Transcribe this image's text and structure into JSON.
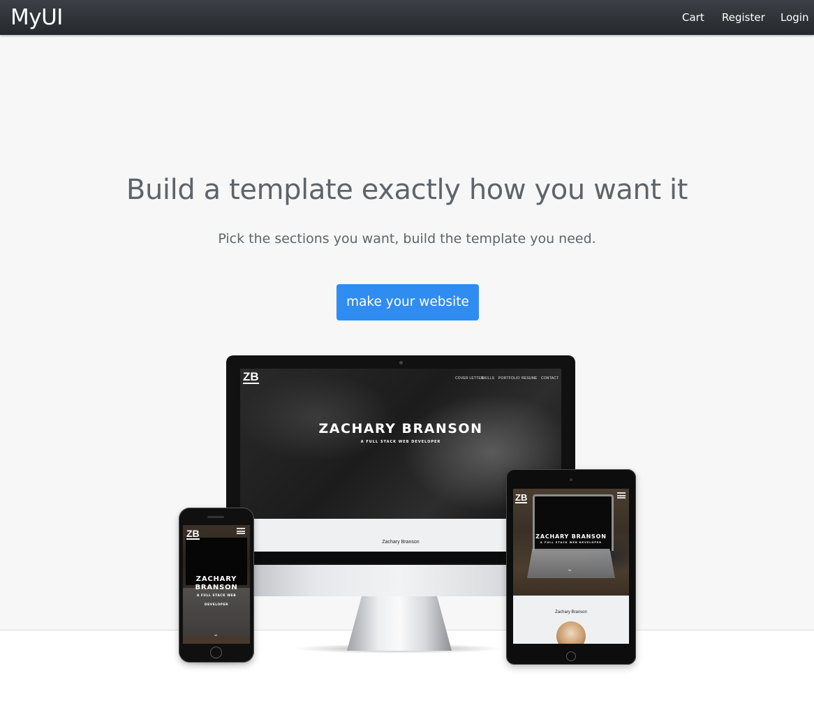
{
  "navbar": {
    "brand": "MyUI",
    "links": {
      "cart": "Cart",
      "register": "Register",
      "login": "Login"
    }
  },
  "hero": {
    "title": "Build a template exactly how you want it",
    "subtitle": "Pick the sections you want, build the template you need.",
    "cta_label": "make your website"
  },
  "mockup": {
    "logo": "ZB",
    "desktop_nav": [
      "COVER LETTER",
      "SKILLS",
      "PORTFOLIO",
      "RESUME",
      "CONTACT"
    ],
    "name": "ZACHARY BRANSON",
    "tagline": "A FULL STACK WEB DEVELOPER",
    "caption": "Zachary Branson",
    "phone_name_line1": "ZACHARY",
    "phone_name_line2": "BRANSON",
    "phone_tag_line1": "A FULL STACK WEB",
    "phone_tag_line2": "DEVELOPER"
  },
  "colors": {
    "navbar": "#2b2e33",
    "hero_bg": "#f7f7f7",
    "heading_text": "#5e6469",
    "cta": "#2f8cf0"
  }
}
